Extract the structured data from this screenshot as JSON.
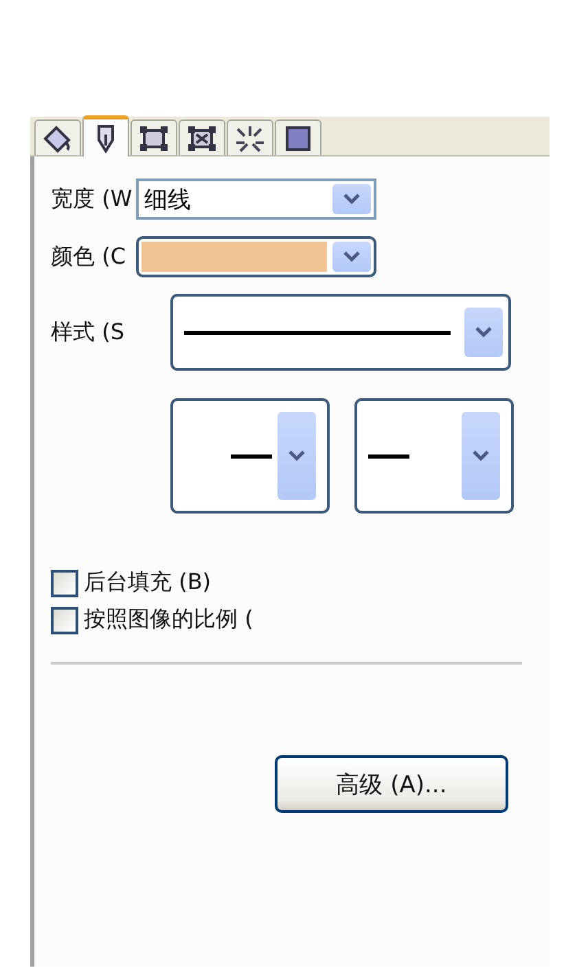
{
  "tabs": [
    {
      "kind": "fill",
      "selected": false
    },
    {
      "kind": "pen",
      "selected": true
    },
    {
      "kind": "frame",
      "selected": false
    },
    {
      "kind": "crossframe",
      "selected": false
    },
    {
      "kind": "effect",
      "selected": false
    },
    {
      "kind": "square",
      "selected": false
    }
  ],
  "width": {
    "label": "宽度 (W",
    "value": "细线"
  },
  "color": {
    "label": "颜色 (C",
    "color": "#f0c592"
  },
  "style": {
    "label": "样式 (S"
  },
  "arrows": [
    {
      "kind": "end"
    },
    {
      "kind": "start"
    }
  ],
  "checkboxes": [
    {
      "label": "后台填充 (B)",
      "checked": false
    },
    {
      "label": "按照图像的比例 (",
      "checked": false
    }
  ],
  "advanced_button": "高级 (A)..."
}
